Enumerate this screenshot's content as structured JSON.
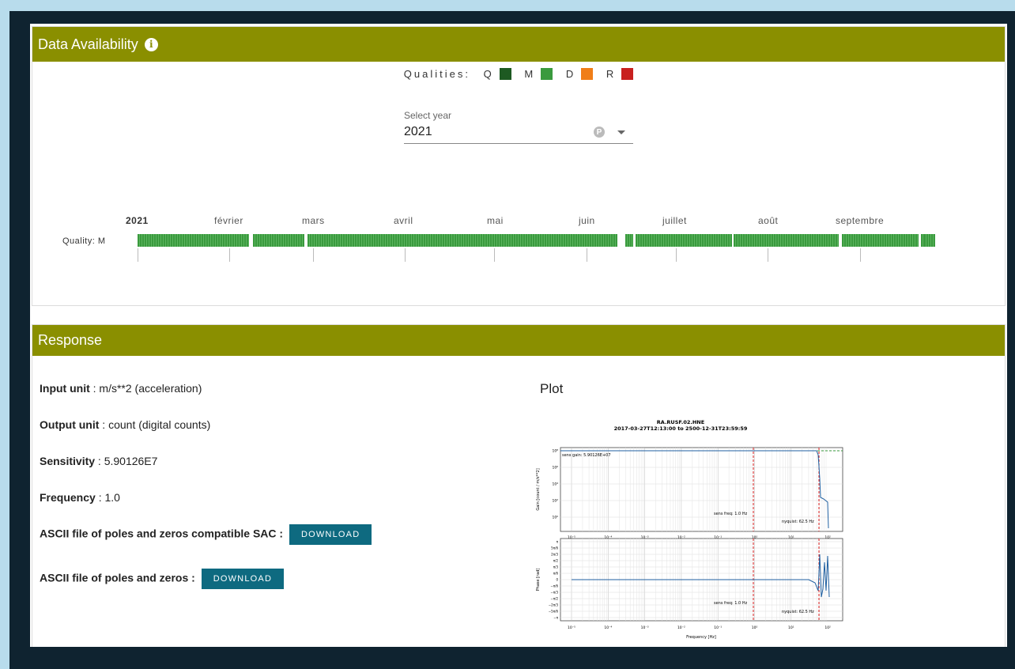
{
  "availability": {
    "title": "Data Availability",
    "qualities_label": "Qualities:",
    "qualities": [
      {
        "code": "Q",
        "color": "#1e5a22"
      },
      {
        "code": "M",
        "color": "#3a9a3e"
      },
      {
        "code": "D",
        "color": "#f07e18"
      },
      {
        "code": "R",
        "color": "#c8201e"
      }
    ],
    "select_label": "Select year",
    "select_value": "2021",
    "timeline": {
      "year_label": "2021",
      "months": [
        "février",
        "mars",
        "avril",
        "mai",
        "juin",
        "juillet",
        "août",
        "septembre"
      ],
      "row_label": "Quality: M",
      "row_quality": "M"
    }
  },
  "response": {
    "title": "Response",
    "fields": [
      {
        "label": "Input unit",
        "value": " : m/s**2 (acceleration)"
      },
      {
        "label": "Output unit",
        "value": " : count (digital counts)"
      },
      {
        "label": "Sensitivity",
        "value": " : 5.90126E7"
      },
      {
        "label": "Frequency",
        "value": " : 1.0"
      }
    ],
    "downloads": [
      {
        "label": "ASCII file of poles and zeros compatible SAC :",
        "button": "DOWNLOAD"
      },
      {
        "label": "ASCII file of poles and zeros :",
        "button": "DOWNLOAD"
      }
    ],
    "plot": {
      "heading": "Plot",
      "title_line1": "RA.RUSF.02.HNE",
      "title_line2": "2017-03-27T12:13:00  to  2500-12-31T23:59:59",
      "gain_ylabel": "Gain [count / m/s**2]",
      "phase_ylabel": "Phase [rad]",
      "xlabel": "Frequency [Hz]",
      "sens_gain_text": "sens gain: 5.90126E+07",
      "sens_freq_text": "sens freq: 1.0 Hz",
      "nyquist_text": "nyquist: 62.5 Hz",
      "x_ticks": [
        "10⁻⁵",
        "10⁻⁴",
        "10⁻³",
        "10⁻²",
        "10⁻¹",
        "10⁰",
        "10¹",
        "10²"
      ],
      "gain_y_ticks": [
        "10⁸",
        "10⁶",
        "10⁴",
        "10²",
        "10⁰"
      ],
      "phase_y_ticks": [
        "π",
        "5π/6",
        "2π/3",
        "π/2",
        "π/3",
        "π/6",
        "0",
        "−π/6",
        "−π/3",
        "−π/2",
        "−2π/3",
        "−5π/6",
        "−π"
      ]
    }
  }
}
